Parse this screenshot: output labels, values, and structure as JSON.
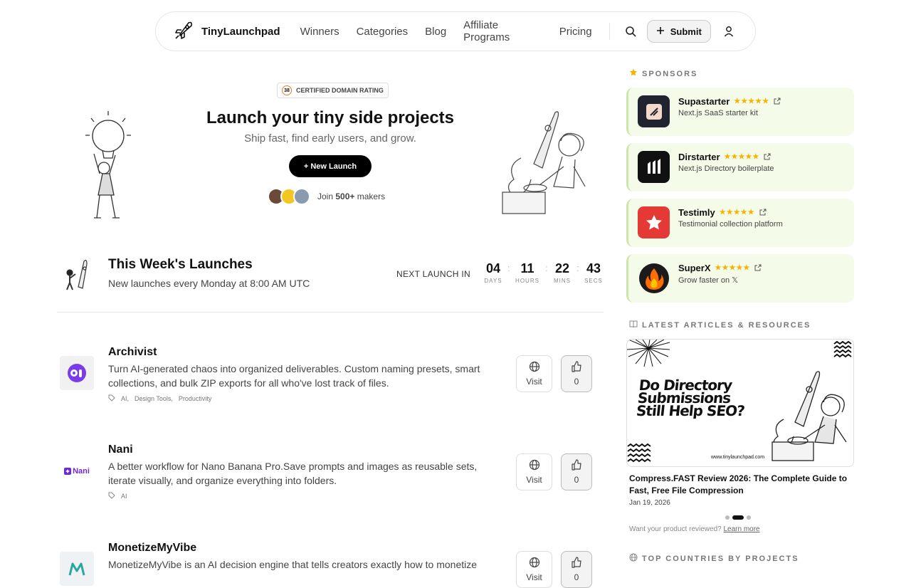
{
  "nav": {
    "brand": "TinyLaunchpad",
    "links": [
      "Winners",
      "Categories",
      "Blog",
      "Affiliate Programs",
      "Pricing"
    ],
    "submit_label": "Submit"
  },
  "hero": {
    "badge_number": "38",
    "badge_text": "CERTIFIED DOMAIN RATING",
    "title": "Launch your tiny side projects",
    "subtitle": "Ship fast, find early users, and grow.",
    "cta": "+ New Launch",
    "join_prefix": "Join",
    "join_count": "500+",
    "join_suffix": "makers"
  },
  "week": {
    "title": "This Week's Launches",
    "subtitle": "New launches every Monday at 8:00 AM UTC",
    "next_label": "NEXT LAUNCH IN",
    "countdown": [
      {
        "value": "04",
        "label": "DAYS"
      },
      {
        "value": "11",
        "label": "HOURS"
      },
      {
        "value": "22",
        "label": "MINS"
      },
      {
        "value": "43",
        "label": "SECS"
      }
    ]
  },
  "products": [
    {
      "name": "Archivist",
      "description": "Turn AI-generated chaos into organized deliverables. Custom naming presets, smart collections, and bulk ZIP exports for all who've lost track of files.",
      "tags": [
        "AI,",
        "Design Tools,",
        "Productivity"
      ],
      "visit": "Visit",
      "votes": "0"
    },
    {
      "name": "Nani",
      "logo_text": "Nani",
      "description": "A better workflow for Nano Banana Pro.Save prompts and images as reusable sets, iterate visually, and organize everything into folders.",
      "tags": [
        "AI"
      ],
      "visit": "Visit",
      "votes": "0"
    },
    {
      "name": "MonetizeMyVibe",
      "description": "MonetizeMyVibe is an AI decision engine that tells creators exactly how to monetize",
      "tags": [],
      "visit": "Visit",
      "votes": "0"
    }
  ],
  "sponsors_heading": "SPONSORS",
  "sponsors": [
    {
      "name": "Supastarter",
      "stars": "★★★★★",
      "description": "Next.js SaaS starter kit"
    },
    {
      "name": "Dirstarter",
      "stars": "★★★★★",
      "description": "Next.js Directory boilerplate"
    },
    {
      "name": "Testimly",
      "stars": "★★★★★",
      "description": "Testimonial collection platform"
    },
    {
      "name": "SuperX",
      "stars": "★★★★★",
      "description": "Grow faster on 𝕏"
    }
  ],
  "articles": {
    "heading": "LATEST ARTICLES & RESOURCES",
    "image_title": "Do Directory Submissions Still Help SEO?",
    "image_url": "www.tinylaunchpad.com",
    "caption": "Compress.FAST Review 2026: The Complete Guide to Fast, Free File Compression",
    "date": "Jan 19, 2026",
    "review_prefix": "Want your product reviewed?",
    "review_link": "Learn more"
  },
  "countries_heading": "TOP COUNTRIES BY PROJECTS",
  "colors": {
    "sponsor_bg": "#f5fbe9",
    "accent_black": "#000000",
    "star": "#f5b301"
  }
}
